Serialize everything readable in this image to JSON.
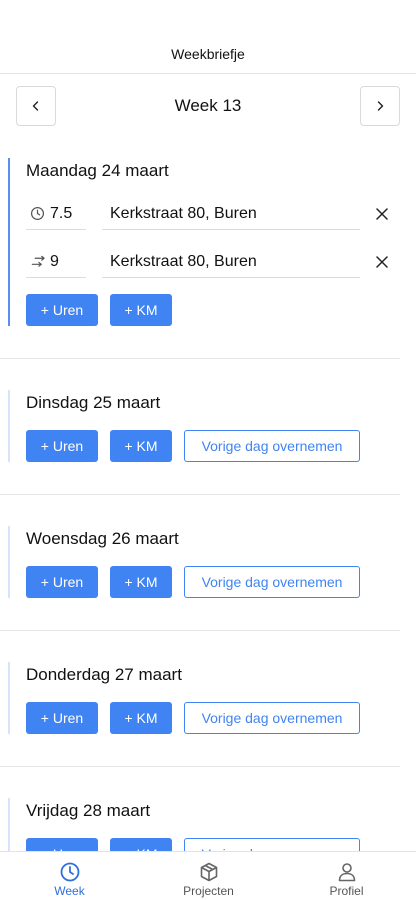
{
  "header": {
    "title": "Weekbriefje"
  },
  "week_nav": {
    "label": "Week 13",
    "prev_icon": "chevron-left-icon",
    "next_icon": "chevron-right-icon"
  },
  "days": [
    {
      "title": "Maandag 24 maart",
      "entries": [
        {
          "type": "uren",
          "icon": "clock-icon",
          "value": "7.5",
          "address": "Kerkstraat 80, Buren"
        },
        {
          "type": "km",
          "icon": "route-icon",
          "value": "9",
          "address": "Kerkstraat 80, Buren"
        }
      ],
      "btn_uren": "+ Uren",
      "btn_km": "+ KM"
    },
    {
      "title": "Dinsdag 25 maart",
      "btn_uren": "+ Uren",
      "btn_km": "+ KM",
      "btn_copy": "Vorige dag overnemen"
    },
    {
      "title": "Woensdag 26 maart",
      "btn_uren": "+ Uren",
      "btn_km": "+ KM",
      "btn_copy": "Vorige dag overnemen"
    },
    {
      "title": "Donderdag 27 maart",
      "btn_uren": "+ Uren",
      "btn_km": "+ KM",
      "btn_copy": "Vorige dag overnemen"
    },
    {
      "title": "Vrijdag 28 maart",
      "btn_uren": "+ Uren",
      "btn_km": "+ KM",
      "btn_copy": "Vorige dag overnemen"
    }
  ],
  "tabs": [
    {
      "label": "Week",
      "icon": "clock-icon",
      "active": true
    },
    {
      "label": "Projecten",
      "icon": "box-icon",
      "active": false
    },
    {
      "label": "Profiel",
      "icon": "user-icon",
      "active": false
    }
  ],
  "colors": {
    "accent": "#3f84f2",
    "active_bar": "#5b8ef0",
    "inactive_bar": "#d6e4fb"
  }
}
